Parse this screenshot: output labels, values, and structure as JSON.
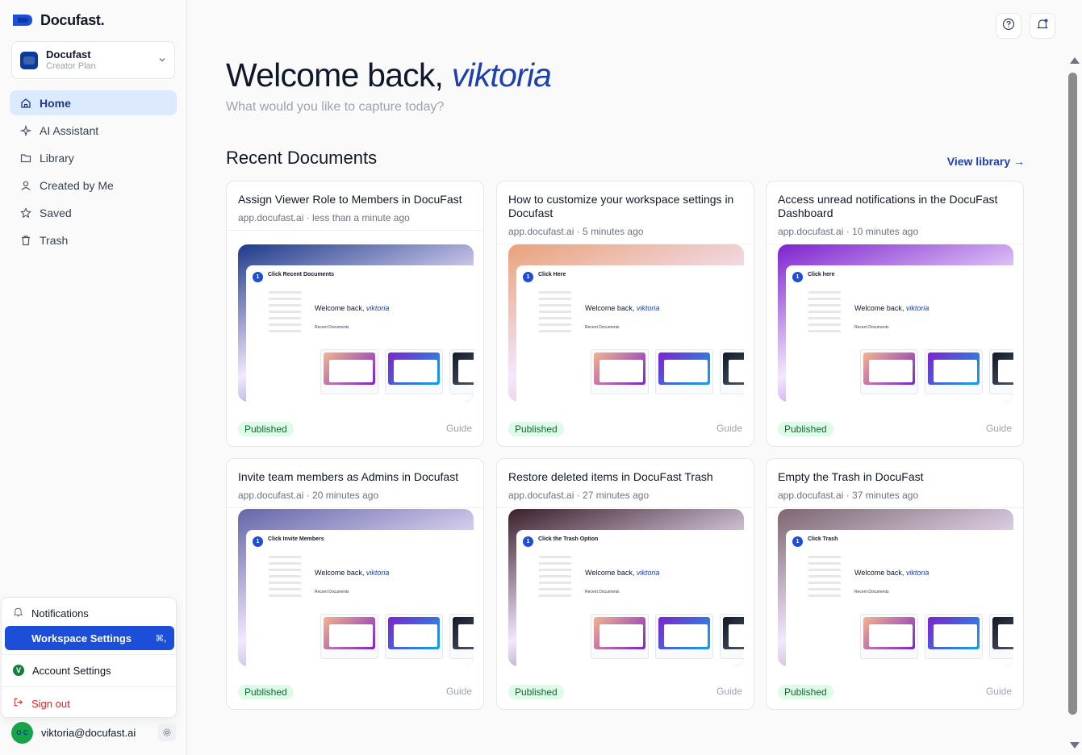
{
  "brand": {
    "name": "Docufast."
  },
  "workspace": {
    "name": "Docufast",
    "plan": "Creator Plan"
  },
  "nav": [
    {
      "label": "Home",
      "icon": "home-icon",
      "active": true
    },
    {
      "label": "AI Assistant",
      "icon": "sparkles-icon"
    },
    {
      "label": "Library",
      "icon": "folder-icon"
    },
    {
      "label": "Created by Me",
      "icon": "user-icon"
    },
    {
      "label": "Saved",
      "icon": "star-icon"
    },
    {
      "label": "Trash",
      "icon": "trash-icon"
    }
  ],
  "menu": {
    "notifications": "Notifications",
    "workspace_settings": "Workspace Settings",
    "workspace_shortcut": "⌘,",
    "account_settings": "Account Settings",
    "sign_out": "Sign out"
  },
  "user": {
    "email": "viktoria@docufast.ai",
    "initials": "O C"
  },
  "header": {
    "welcome_prefix": "Welcome back,",
    "user_name": "viktoria",
    "subtitle": "What would you like to capture today?",
    "recent_title": "Recent Documents",
    "view_library": "View library →"
  },
  "documents": [
    {
      "title": "Assign Viewer Role to Members in DocuFast",
      "meta": "app.docufast.ai · less than a minute ago",
      "step_title": "Click Recent Documents",
      "status": "Published",
      "type": "Guide",
      "accent": "#1e3a8a"
    },
    {
      "title": "How to customize your workspace settings in Docufast",
      "meta": "app.docufast.ai · 5 minutes ago",
      "step_title": "Click Here",
      "status": "Published",
      "type": "Guide",
      "accent": "#e9a27a"
    },
    {
      "title": "Access unread notifications in the DocuFast Dashboard",
      "meta": "app.docufast.ai · 10 minutes ago",
      "step_title": "Click here",
      "status": "Published",
      "type": "Guide",
      "accent": "#7e22ce"
    },
    {
      "title": "Invite team members as Admins in Docufast",
      "meta": "app.docufast.ai · 20 minutes ago",
      "step_title": "Click Invite Members",
      "status": "Published",
      "type": "Guide",
      "accent": "#6366a8"
    },
    {
      "title": "Restore deleted items in DocuFast Trash",
      "meta": "app.docufast.ai · 27 minutes ago",
      "step_title": "Click the Trash Option",
      "status": "Published",
      "type": "Guide",
      "accent": "#3b1f2b"
    },
    {
      "title": "Empty the Trash in DocuFast",
      "meta": "app.docufast.ai · 37 minutes ago",
      "step_title": "Click Trash",
      "status": "Published",
      "type": "Guide",
      "accent": "#7c6670"
    }
  ],
  "colors": {
    "brand": "#1d4ed8",
    "accent_name": "#1e40af",
    "published_bg": "#dcfce7",
    "published_fg": "#166534"
  }
}
